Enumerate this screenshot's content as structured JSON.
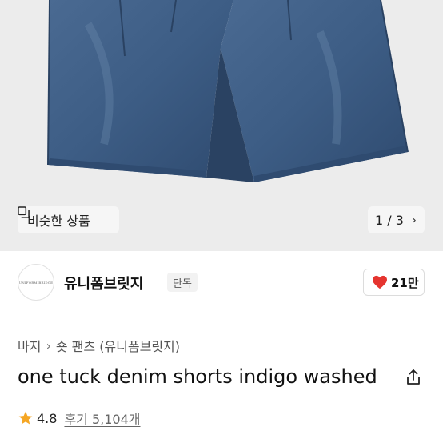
{
  "image": {
    "similar_label": "비슷한 상품",
    "pager": "1 / 3",
    "colors": {
      "background": "#ececec",
      "denim": "#3f5f86",
      "denim_dark": "#2c4668"
    }
  },
  "brand": {
    "logo_text": "UNIFORM BRIDGE",
    "name": "유니폼브릿지",
    "badge": "단독",
    "likes": "21만",
    "like_color": "#e5342f"
  },
  "breadcrumb": {
    "category": "바지",
    "subcategory": "숏 팬츠 (유니폼브릿지)"
  },
  "product": {
    "title": "one tuck denim shorts indigo washed"
  },
  "rating": {
    "score": "4.8",
    "review_label": "후기 5,104개",
    "star_color": "#f5a623"
  }
}
